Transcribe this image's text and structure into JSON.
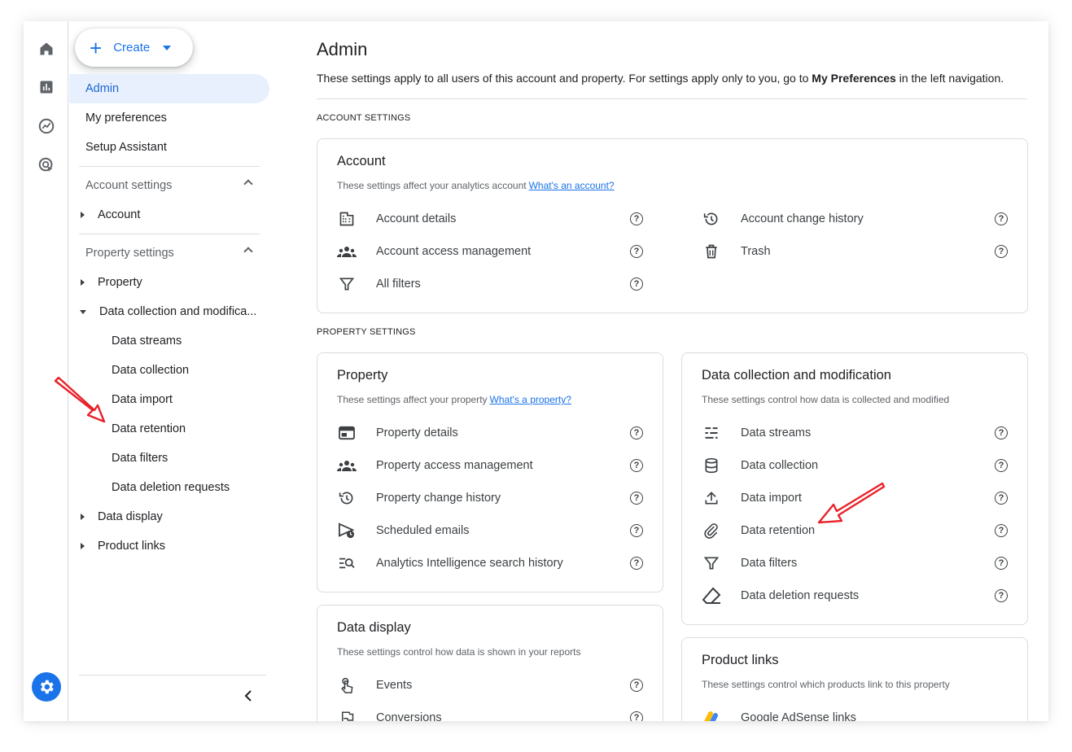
{
  "create": {
    "label": "Create"
  },
  "nav": {
    "admin": "Admin",
    "my_preferences": "My preferences",
    "setup_assistant": "Setup Assistant",
    "account_settings": "Account settings",
    "account": "Account",
    "property_settings": "Property settings",
    "property": "Property",
    "data_collection_mod": "Data collection and modifica...",
    "data_streams": "Data streams",
    "data_collection": "Data collection",
    "data_import": "Data import",
    "data_retention": "Data retention",
    "data_filters": "Data filters",
    "data_deletion": "Data deletion requests",
    "data_display": "Data display",
    "product_links": "Product links"
  },
  "page": {
    "title": "Admin",
    "desc_pre": "These settings apply to all users of this account and property. For settings apply only to you, go to ",
    "desc_bold": "My Preferences",
    "desc_post": " in the left navigation.",
    "account_settings_label": "ACCOUNT SETTINGS",
    "property_settings_label": "PROPERTY SETTINGS"
  },
  "account_card": {
    "title": "Account",
    "desc": "These settings affect your analytics account",
    "link": "What's an account?",
    "items": [
      "Account details",
      "Account access management",
      "All filters",
      "Account change history",
      "Trash"
    ]
  },
  "property_card": {
    "title": "Property",
    "desc": "These settings affect your property",
    "link": "What's a property?",
    "items": [
      "Property details",
      "Property access management",
      "Property change history",
      "Scheduled emails",
      "Analytics Intelligence search history"
    ]
  },
  "dcm_card": {
    "title": "Data collection and modification",
    "desc": "These settings control how data is collected and modified",
    "items": [
      "Data streams",
      "Data collection",
      "Data import",
      "Data retention",
      "Data filters",
      "Data deletion requests"
    ]
  },
  "display_card": {
    "title": "Data display",
    "desc": "These settings control how data is shown in your reports",
    "items": [
      "Events",
      "Conversions"
    ]
  },
  "links_card": {
    "title": "Product links",
    "desc": "These settings control which products link to this property",
    "items": [
      "Google AdSense links"
    ]
  },
  "help_glyph": "?",
  "colors": {
    "accent": "#1a73e8",
    "active_bg": "#e8f0fe",
    "annotation_red": "#e8222a"
  }
}
